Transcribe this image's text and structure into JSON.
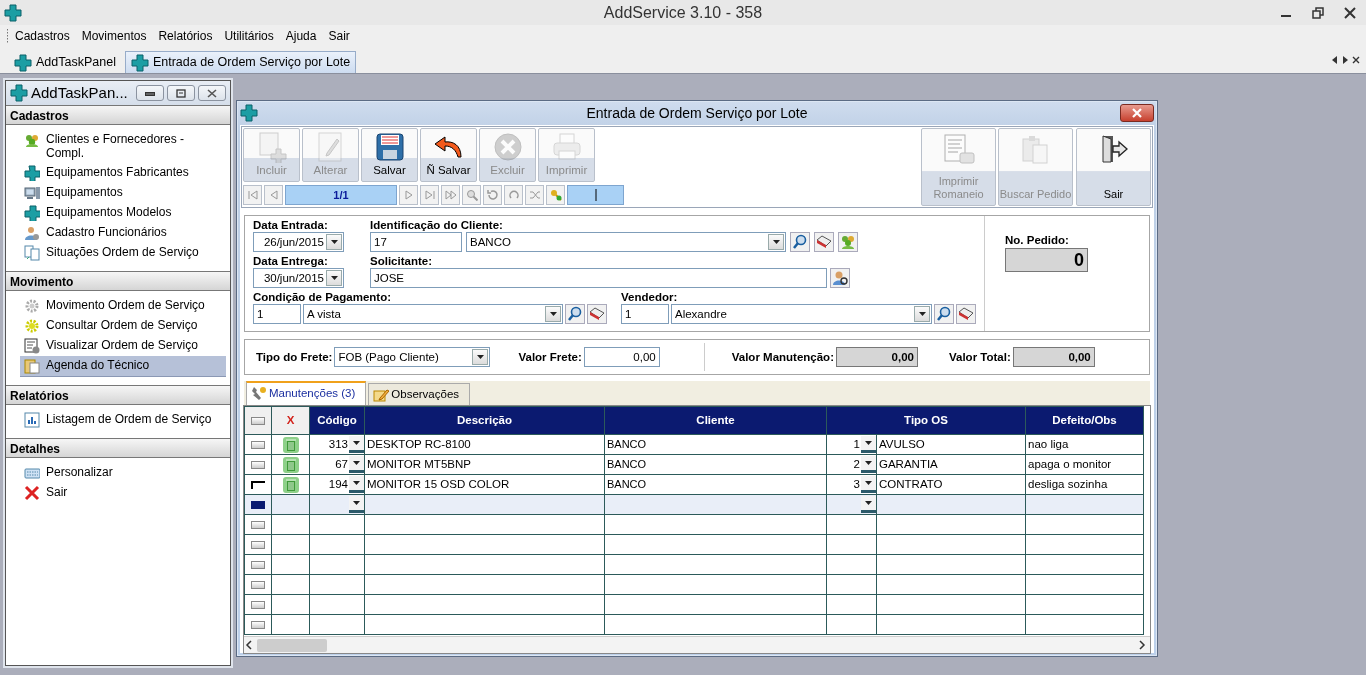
{
  "window": {
    "title": "AddService 3.10 - 358"
  },
  "menu": [
    "Cadastros",
    "Movimentos",
    "Relatórios",
    "Utilitários",
    "Ajuda",
    "Sair"
  ],
  "document_tabs": [
    {
      "label": "AddTaskPanel",
      "selected": false
    },
    {
      "label": "Entrada de Ordem Serviço por Lote",
      "selected": true
    }
  ],
  "task_panel": {
    "title": "AddTaskPan...",
    "sections": [
      {
        "title": "Cadastros",
        "items": [
          {
            "label": "Clientes e Fornecedores - Compl.",
            "selected": false
          },
          {
            "label": "Equipamentos Fabricantes",
            "selected": false
          },
          {
            "label": "Equipamentos",
            "selected": false
          },
          {
            "label": "Equipamentos Modelos",
            "selected": false
          },
          {
            "label": "Cadastro Funcionários",
            "selected": false
          },
          {
            "label": "Situações Ordem de Serviço",
            "selected": false
          }
        ]
      },
      {
        "title": "Movimento",
        "items": [
          {
            "label": "Movimento Ordem de Serviço",
            "selected": false
          },
          {
            "label": "Consultar Ordem de Serviço",
            "selected": false
          },
          {
            "label": "Visualizar Ordem de Serviço",
            "selected": false
          },
          {
            "label": "Agenda do Técnico",
            "selected": true
          }
        ]
      },
      {
        "title": "Relatórios",
        "items": [
          {
            "label": "Listagem de Ordem de Serviço",
            "selected": false
          }
        ]
      },
      {
        "title": "Detalhes",
        "items": [
          {
            "label": "Personalizar",
            "selected": false
          },
          {
            "label": "Sair",
            "selected": false
          }
        ]
      }
    ]
  },
  "form_window": {
    "title": "Entrada de Ordem Serviço por Lote",
    "toolbar": [
      {
        "label": "Incluir",
        "disabled": true
      },
      {
        "label": "Alterar",
        "disabled": true
      },
      {
        "label": "Salvar",
        "disabled": false
      },
      {
        "label": "Ñ Salvar",
        "disabled": false
      },
      {
        "label": "Excluir",
        "disabled": true
      },
      {
        "label": "Imprimir",
        "disabled": true
      }
    ],
    "right_toolbar": [
      {
        "label": "Imprimir Romaneio",
        "disabled": true
      },
      {
        "label": "Buscar Pedido",
        "disabled": true
      },
      {
        "label": "Sair",
        "disabled": false
      }
    ],
    "record_position": "1/1",
    "data_entrada": {
      "label": "Data Entrada:",
      "value": "26/jun/2015"
    },
    "data_entrega": {
      "label": "Data Entrega:",
      "value": "30/jun/2015"
    },
    "cliente": {
      "label": "Identificação do Cliente:",
      "code": "17",
      "name": "BANCO"
    },
    "solicitante": {
      "label": "Solicitante:",
      "value": "JOSE"
    },
    "condicao_pagamento": {
      "label": "Condição de Pagamento:",
      "code": "1",
      "name": "A vista"
    },
    "vendedor": {
      "label": "Vendedor:",
      "code": "1",
      "name": "Alexandre"
    },
    "no_pedido": {
      "label": "No. Pedido:",
      "value": "0"
    },
    "tipo_frete": {
      "label": "Tipo do Frete:",
      "value": "FOB (Pago Cliente)"
    },
    "valor_frete": {
      "label": "Valor Frete:",
      "value": "0,00"
    },
    "valor_manutencao": {
      "label": "Valor Manutenção:",
      "value": "0,00"
    },
    "valor_total": {
      "label": "Valor Total:",
      "value": "0,00"
    },
    "tabs": [
      {
        "label": "Manutenções (3)",
        "selected": true
      },
      {
        "label": "Observações",
        "selected": false
      }
    ],
    "grid": {
      "delete_header": "X",
      "columns": [
        "Código",
        "Descrição",
        "Cliente",
        "Tipo OS",
        "Defeito/Obs"
      ],
      "rows": [
        {
          "kind": "item",
          "current": false,
          "codigo": "313",
          "descricao": "DESKTOP RC-8100",
          "cliente": "BANCO",
          "tipo_code": "1",
          "tipo": "AVULSO",
          "defeito": "nao liga"
        },
        {
          "kind": "item",
          "current": false,
          "codigo": "67",
          "descricao": "MONITOR MT5BNP",
          "cliente": "BANCO",
          "tipo_code": "2",
          "tipo": "GARANTIA",
          "defeito": "apaga o monitor"
        },
        {
          "kind": "item",
          "current": true,
          "codigo": "194",
          "descricao": "MONITOR 15 OSD COLOR",
          "cliente": "BANCO",
          "tipo_code": "3",
          "tipo": "CONTRATO",
          "defeito": "desliga sozinha"
        },
        {
          "kind": "new"
        },
        {
          "kind": "blank"
        },
        {
          "kind": "blank"
        },
        {
          "kind": "blank"
        },
        {
          "kind": "blank"
        },
        {
          "kind": "blank"
        },
        {
          "kind": "blank"
        }
      ]
    }
  }
}
